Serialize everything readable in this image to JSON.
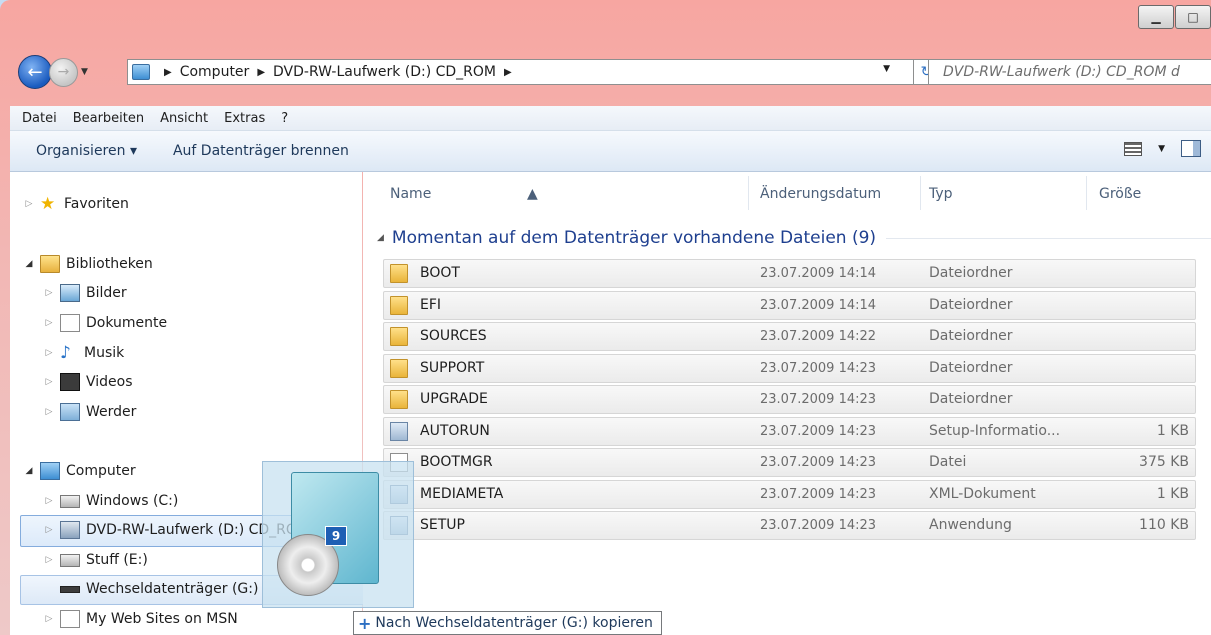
{
  "window": {
    "caption_minimize": "▁",
    "caption_maximize": "□"
  },
  "nav": {
    "back_icon": "arrow-left",
    "forward_icon": "arrow-right",
    "address": {
      "segments": [
        "Computer",
        "DVD-RW-Laufwerk (D:) CD_ROM"
      ]
    },
    "refresh_icon": "refresh",
    "search_placeholder": "DVD-RW-Laufwerk (D:) CD_ROM d"
  },
  "menu": [
    "Datei",
    "Bearbeiten",
    "Ansicht",
    "Extras",
    "?"
  ],
  "toolbar": {
    "organize": "Organisieren ▾",
    "burn": "Auf Datenträger brennen"
  },
  "tree": {
    "favorites": "Favoriten",
    "libraries": "Bibliotheken",
    "pictures": "Bilder",
    "documents": "Dokumente",
    "music": "Musik",
    "videos": "Videos",
    "werder": "Werder",
    "computer": "Computer",
    "windows": "Windows (C:)",
    "dvd": "DVD-RW-Laufwerk (D:) CD_ROM",
    "stuff": "Stuff (E:)",
    "removable": "Wechseldatenträger (G:)",
    "msn": "My Web Sites on MSN"
  },
  "columns": {
    "name": "Name",
    "date": "Änderungsdatum",
    "type": "Typ",
    "size": "Größe"
  },
  "group": {
    "title": "Momentan auf dem Datenträger vorhandene Dateien (9)"
  },
  "files": [
    {
      "name": "BOOT",
      "date": "23.07.2009 14:14",
      "type": "Dateiordner",
      "size": ""
    },
    {
      "name": "EFI",
      "date": "23.07.2009 14:14",
      "type": "Dateiordner",
      "size": ""
    },
    {
      "name": "SOURCES",
      "date": "23.07.2009 14:22",
      "type": "Dateiordner",
      "size": ""
    },
    {
      "name": "SUPPORT",
      "date": "23.07.2009 14:23",
      "type": "Dateiordner",
      "size": ""
    },
    {
      "name": "UPGRADE",
      "date": "23.07.2009 14:23",
      "type": "Dateiordner",
      "size": ""
    },
    {
      "name": "AUTORUN",
      "date": "23.07.2009 14:23",
      "type": "Setup-Informatio...",
      "size": "1 KB"
    },
    {
      "name": "BOOTMGR",
      "date": "23.07.2009 14:23",
      "type": "Datei",
      "size": "375 KB"
    },
    {
      "name": "MEDIAMETA",
      "date": "23.07.2009 14:23",
      "type": "XML-Dokument",
      "size": "1 KB"
    },
    {
      "name": "SETUP",
      "date": "23.07.2009 14:23",
      "type": "Anwendung",
      "size": "110 KB"
    }
  ],
  "drag": {
    "count": "9",
    "tooltip": "Nach Wechseldatenträger (G:) kopieren"
  }
}
